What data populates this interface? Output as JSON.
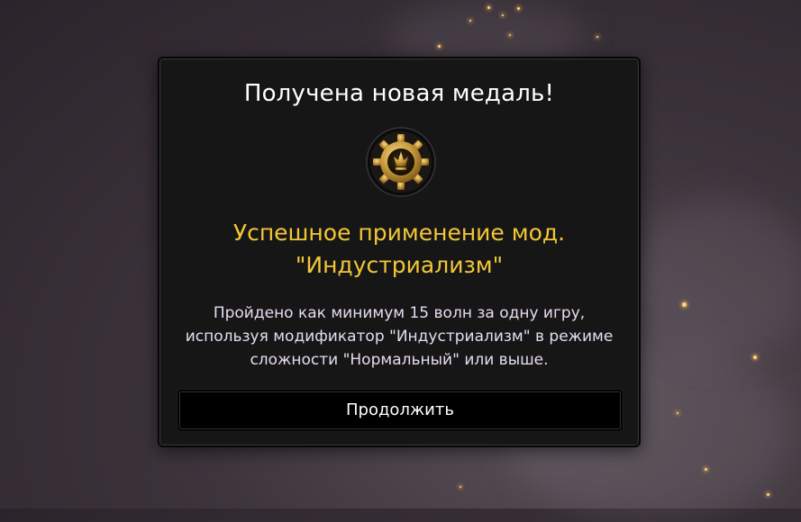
{
  "dialog": {
    "title": "Получена новая медаль!",
    "medal_name": "Успешное применение мод. \"Индустриализм\"",
    "description": "Пройдено как минимум 15 волн за одну игру, используя модификатор \"Индустриализм\" в режиме сложности \"Нормальный\" или выше.",
    "continue_label": "Продолжить",
    "medal_icon": "gear-medal-icon"
  },
  "colors": {
    "title": "#ffffff",
    "medal_name": "#f2c736",
    "description": "#e6dcef",
    "panel": "#171617",
    "button": "#000000"
  }
}
